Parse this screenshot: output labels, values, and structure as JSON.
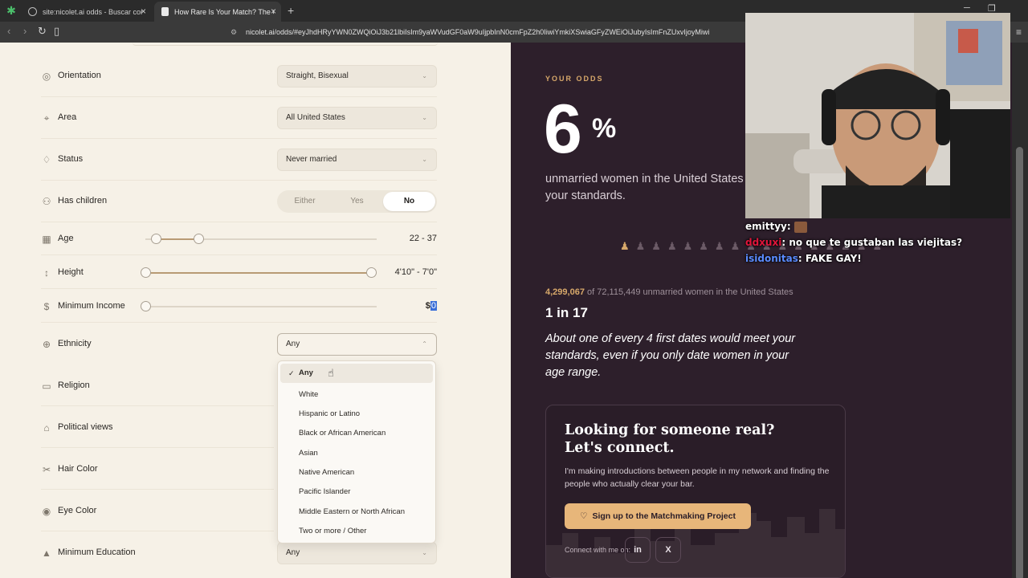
{
  "browser": {
    "tabs": [
      {
        "title": "site:nicolet.ai odds - Buscar con Goo"
      },
      {
        "title": "How Rare Is Your Match? The Od"
      }
    ],
    "url": "nicolet.ai/odds/#eyJhdHRyYWN0ZWQiOiJ3b21lbiIsIm9yaWVudGF0aW9uIjpbInN0cmFpZ2h0IiwiYmkiXSwiaGFyZWEiOiJubyIsImFnZUxvIjoyMiwi"
  },
  "filters": {
    "orientation": {
      "label": "Orientation",
      "value": "Straight, Bisexual"
    },
    "area": {
      "label": "Area",
      "value": "All United States"
    },
    "status": {
      "label": "Status",
      "value": "Never married"
    },
    "children": {
      "label": "Has children",
      "options": [
        "Either",
        "Yes",
        "No"
      ],
      "selected": "No"
    },
    "age": {
      "label": "Age",
      "value_text": "22 - 37",
      "min": 22,
      "max": 37
    },
    "height": {
      "label": "Height",
      "value_text": "4'10\" - 7'0\""
    },
    "income": {
      "label": "Minimum Income",
      "currency": "$",
      "value": "0"
    },
    "ethnicity": {
      "label": "Ethnicity",
      "value": "Any",
      "options": [
        "Any",
        "White",
        "Hispanic or Latino",
        "Black or African American",
        "Asian",
        "Native American",
        "Pacific Islander",
        "Middle Eastern or North African",
        "Two or more / Other"
      ],
      "selected": "Any"
    },
    "religion": {
      "label": "Religion"
    },
    "political": {
      "label": "Political views"
    },
    "hair": {
      "label": "Hair Color"
    },
    "eye": {
      "label": "Eye Color"
    },
    "education": {
      "label": "Minimum Education",
      "value": "Any"
    }
  },
  "results": {
    "kicker": "YOUR ODDS",
    "percent": "6",
    "percent_sign": "%",
    "description": "unmarried women in the United States meet your standards.",
    "count_highlight": "4,299,067",
    "count_rest": "of 72,115,449 unmarried women in the United States",
    "ratio": "1 in 17",
    "quote": "About one of every 4 first dates would meet your standards, even if you only date women in your age range."
  },
  "card": {
    "title": "Looking for someone real? Let's connect.",
    "text": "I'm making introductions between people in my network and finding the people who actually clear your bar.",
    "cta": "Sign up to the Matchmaking Project",
    "connect": "Connect with me on:",
    "social": [
      "in",
      "X"
    ]
  },
  "chat": [
    {
      "user": "emittyy",
      "message": ""
    },
    {
      "user": "ddxuxi",
      "message": "no que te gustaban las viejitas?"
    },
    {
      "user": "isidonitas",
      "message": "FAKE GAY!"
    }
  ],
  "colors": {
    "accent": "#d7a86a",
    "panel_dark": "#2d1f2b",
    "panel_light": "#f6f1e7",
    "cta": "#e7b67a"
  }
}
